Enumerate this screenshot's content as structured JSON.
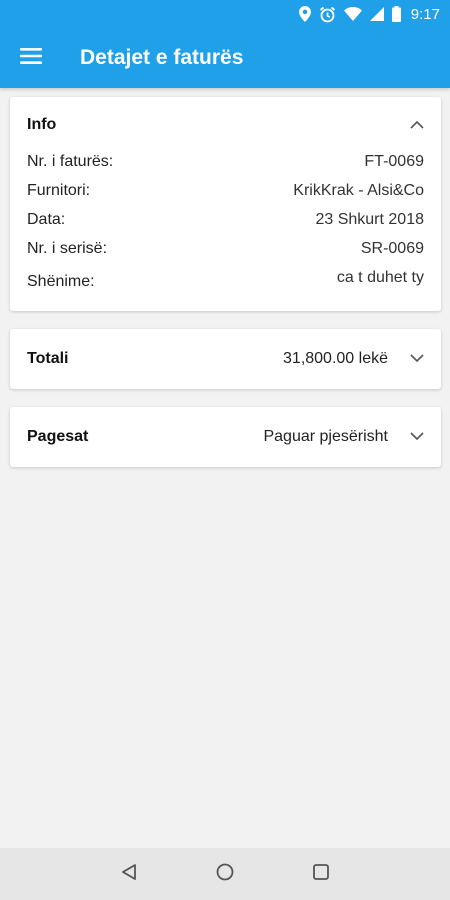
{
  "status_bar": {
    "time": "9:17",
    "icons": [
      "location-icon",
      "alarm-icon",
      "wifi-icon",
      "signal-icon",
      "battery-icon"
    ]
  },
  "app_bar": {
    "title": "Detajet e faturës",
    "menu_icon": "menu-icon"
  },
  "info_card": {
    "title": "Info",
    "rows": [
      {
        "label": "Nr. i faturës:",
        "value": "FT-0069"
      },
      {
        "label": "Furnitori:",
        "value": "KrikKrak - Alsi&Co"
      },
      {
        "label": "Data:",
        "value": "23 Shkurt 2018"
      },
      {
        "label": "Nr. i serisë:",
        "value": "SR-0069"
      },
      {
        "label": "Shënime:",
        "value": "ca t duhet ty"
      }
    ]
  },
  "total_card": {
    "title": "Totali",
    "value": "31,800.00 lekë"
  },
  "payments_card": {
    "title": "Pagesat",
    "value": "Paguar pjesërisht"
  },
  "colors": {
    "primary": "#1fa0e8",
    "background": "#f2f2f2",
    "card": "#ffffff"
  }
}
